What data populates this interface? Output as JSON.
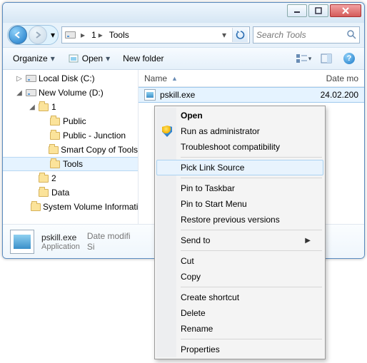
{
  "window": {
    "min_tip": "Minimize",
    "max_tip": "Maximize",
    "close_tip": "Close"
  },
  "nav": {
    "back_tip": "Back",
    "forward_tip": "Forward",
    "crumbs": [
      "1",
      "Tools"
    ],
    "refresh_tip": "Refresh"
  },
  "search": {
    "placeholder": "Search Tools"
  },
  "toolbar": {
    "organize": "Organize",
    "open": "Open",
    "newfolder": "New folder",
    "view_tip": "Change your view",
    "preview_tip": "Show the preview pane",
    "help_tip": "Get help"
  },
  "tree": {
    "items": [
      {
        "label": "Local Disk (C:)",
        "type": "drive",
        "indent": 1,
        "exp": "▷"
      },
      {
        "label": "New Volume (D:)",
        "type": "drive",
        "indent": 1,
        "exp": "◢"
      },
      {
        "label": "1",
        "type": "folder",
        "indent": 2,
        "exp": "◢"
      },
      {
        "label": "Public",
        "type": "folder",
        "indent": 3,
        "exp": ""
      },
      {
        "label": "Public - Junction",
        "type": "folder",
        "indent": 3,
        "exp": ""
      },
      {
        "label": "Smart Copy of Tools",
        "type": "folder",
        "indent": 3,
        "exp": ""
      },
      {
        "label": "Tools",
        "type": "folder",
        "indent": 3,
        "exp": "",
        "selected": true
      },
      {
        "label": "2",
        "type": "folder",
        "indent": 2,
        "exp": ""
      },
      {
        "label": "Data",
        "type": "folder",
        "indent": 2,
        "exp": ""
      },
      {
        "label": "System Volume Information",
        "type": "folder",
        "indent": 2,
        "exp": ""
      }
    ]
  },
  "list": {
    "col_name": "Name",
    "col_date": "Date mo",
    "rows": [
      {
        "name": "pskill.exe",
        "date": "24.02.200",
        "selected": true
      }
    ]
  },
  "details": {
    "filename": "pskill.exe",
    "filetype": "Application",
    "meta_modified_label": "Date modifi",
    "meta_size_label": "Si"
  },
  "context_menu": {
    "items": [
      {
        "label": "Open",
        "bold": true
      },
      {
        "label": "Run as administrator",
        "icon": "shield"
      },
      {
        "label": "Troubleshoot compatibility"
      },
      {
        "sep": true
      },
      {
        "label": "Pick Link Source",
        "hover": true
      },
      {
        "sep": true
      },
      {
        "label": "Pin to Taskbar"
      },
      {
        "label": "Pin to Start Menu"
      },
      {
        "label": "Restore previous versions"
      },
      {
        "sep": true
      },
      {
        "label": "Send to",
        "submenu": true
      },
      {
        "sep": true
      },
      {
        "label": "Cut"
      },
      {
        "label": "Copy"
      },
      {
        "sep": true
      },
      {
        "label": "Create shortcut"
      },
      {
        "label": "Delete"
      },
      {
        "label": "Rename"
      },
      {
        "sep": true
      },
      {
        "label": "Properties"
      }
    ]
  }
}
